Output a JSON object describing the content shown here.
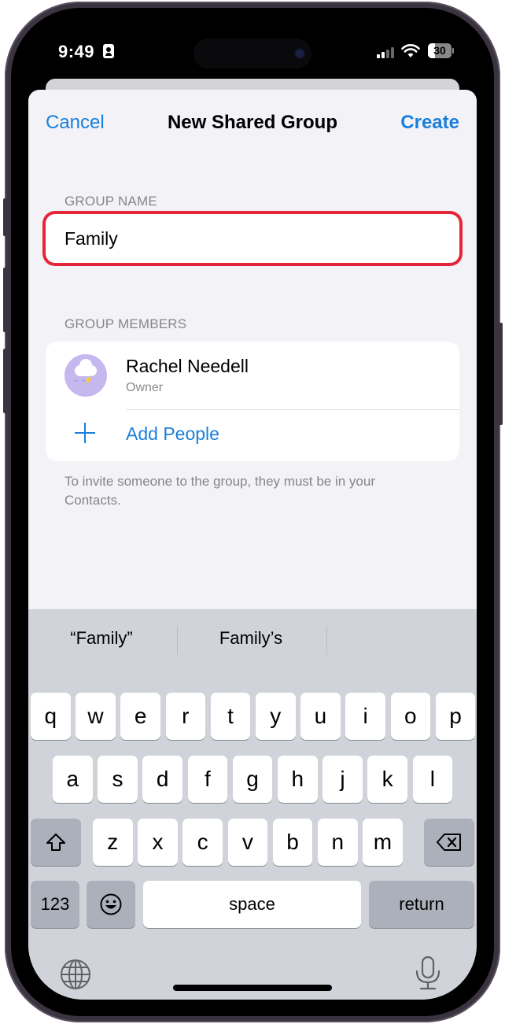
{
  "status_bar": {
    "time": "9:49",
    "battery_level": "30",
    "icons": [
      "contact-card-icon",
      "signal-icon",
      "wifi-icon",
      "battery-icon"
    ]
  },
  "nav": {
    "cancel_label": "Cancel",
    "title": "New Shared Group",
    "create_label": "Create"
  },
  "group_name": {
    "label": "GROUP NAME",
    "value": "Family",
    "highlight_color": "#e5253a"
  },
  "group_members": {
    "label": "GROUP MEMBERS",
    "members": [
      {
        "name": "Rachel Needell",
        "role": "Owner",
        "avatar_icon": "cloud-storm-icon"
      }
    ],
    "add_label": "Add People",
    "footnote": "To invite someone to the group, they must be in your Contacts."
  },
  "keyboard": {
    "suggestions": [
      "“Family”",
      "Family’s",
      ""
    ],
    "row1": [
      "q",
      "w",
      "e",
      "r",
      "t",
      "y",
      "u",
      "i",
      "o",
      "p"
    ],
    "row2": [
      "a",
      "s",
      "d",
      "f",
      "g",
      "h",
      "j",
      "k",
      "l"
    ],
    "row3": [
      "z",
      "x",
      "c",
      "v",
      "b",
      "n",
      "m"
    ],
    "numbers_label": "123",
    "space_label": "space",
    "return_label": "return"
  },
  "colors": {
    "accent": "#1a7fdc",
    "background": "#f2f2f7",
    "keyboard_bg": "#d0d3d9"
  }
}
